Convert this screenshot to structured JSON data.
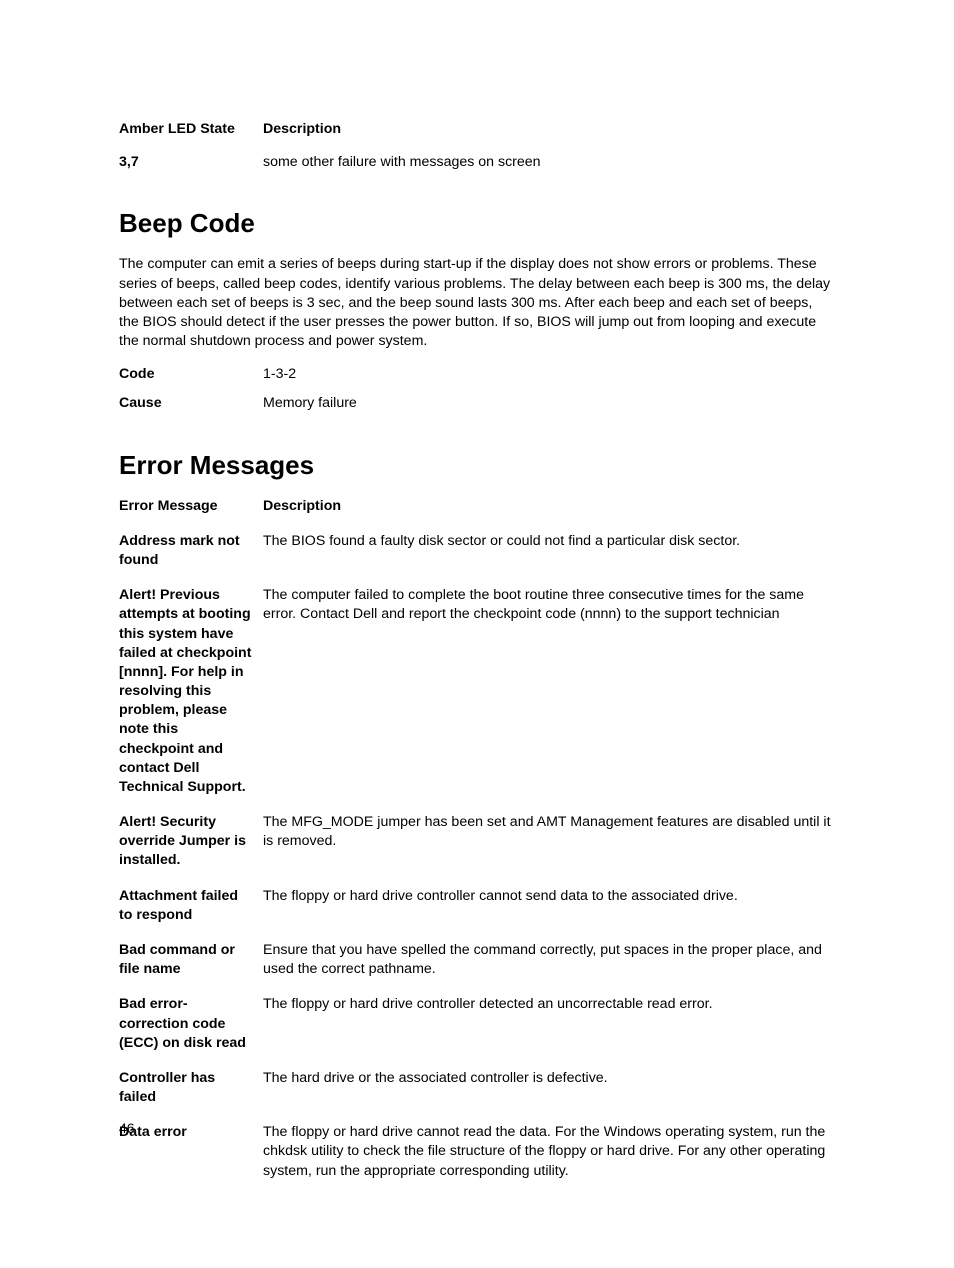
{
  "led_table": {
    "headers": {
      "state": "Amber LED State",
      "desc": "Description"
    },
    "row": {
      "state": "3,7",
      "desc": "some other failure with messages on screen"
    }
  },
  "beep": {
    "heading": "Beep Code",
    "para": "The computer can emit a series of beeps during start-up if the display does not show errors or problems. These series of beeps, called beep codes, identify various problems. The delay between each beep is 300 ms, the delay between each set of beeps is 3 sec, and the beep sound lasts 300 ms. After each beep and each set of beeps, the BIOS should detect if the user presses the power button. If so, BIOS will jump out from looping and execute the normal shutdown process and power system.",
    "rows": [
      {
        "term": "Code",
        "value": "1-3-2"
      },
      {
        "term": "Cause",
        "value": "Memory failure"
      }
    ]
  },
  "errors": {
    "heading": "Error Messages",
    "headers": {
      "msg": "Error Message",
      "desc": "Description"
    },
    "rows": [
      {
        "msg": "Address mark not found",
        "desc": "The BIOS found a faulty disk sector or could not find a particular disk sector."
      },
      {
        "msg": "Alert! Previous attempts at booting this system have failed at checkpoint [nnnn]. For help in resolving this problem, please note this checkpoint and contact Dell Technical Support.",
        "desc": "The computer failed to complete the boot routine three consecutive times for the same error. Contact Dell and report the checkpoint code (nnnn) to the support technician"
      },
      {
        "msg": "Alert! Security override Jumper is installed.",
        "desc": "The MFG_MODE jumper has been set and AMT Management features are disabled until it is removed."
      },
      {
        "msg": "Attachment failed to respond",
        "desc": "The floppy or hard drive controller cannot send data to the associated drive."
      },
      {
        "msg": "Bad command or file name",
        "desc": "Ensure that you have spelled the command correctly, put spaces in the proper place, and used the correct pathname."
      },
      {
        "msg": "Bad error-correction code (ECC) on disk read",
        "desc": "The floppy or hard drive controller detected an uncorrectable read error."
      },
      {
        "msg": "Controller has failed",
        "desc": "The hard drive or the associated controller is defective."
      },
      {
        "msg": "Data error",
        "desc": "The floppy or hard drive cannot read the data. For the Windows operating system, run the chkdsk utility to check the file structure of the floppy or hard drive. For any other operating system, run the appropriate corresponding utility."
      }
    ]
  },
  "page_number": "46"
}
